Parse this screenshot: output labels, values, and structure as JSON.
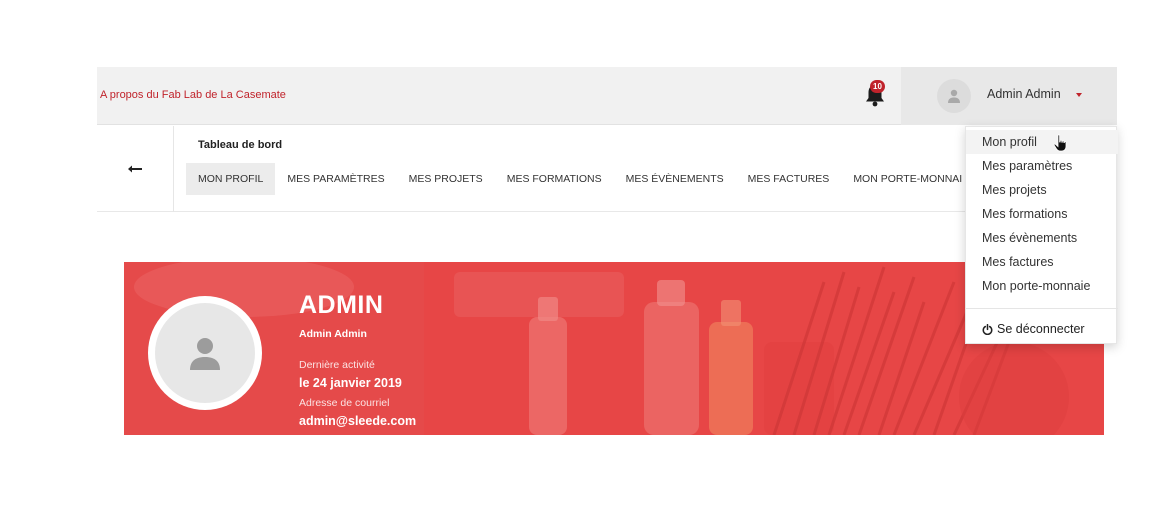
{
  "topbar": {
    "about_link": "A propos du Fab Lab de La Casemate",
    "notifications": {
      "count": "10",
      "icon": "bell-icon"
    },
    "user": {
      "name": "Admin Admin",
      "avatar_icon": "user-icon"
    }
  },
  "subnav": {
    "back_icon": "arrow-left-icon",
    "page_title": "Tableau de bord",
    "tabs": [
      {
        "label": "MON PROFIL",
        "active": true
      },
      {
        "label": "MES PARAMÈTRES"
      },
      {
        "label": "MES PROJETS"
      },
      {
        "label": "MES FORMATIONS"
      },
      {
        "label": "MES ÉVÈNEMENTS"
      },
      {
        "label": "MES FACTURES"
      },
      {
        "label": "MON PORTE-MONNAI"
      }
    ]
  },
  "dropdown": {
    "items": [
      {
        "label": "Mon profil"
      },
      {
        "label": "Mes paramètres"
      },
      {
        "label": "Mes projets"
      },
      {
        "label": "Mes formations"
      },
      {
        "label": "Mes évènements"
      },
      {
        "label": "Mes factures"
      },
      {
        "label": "Mon porte-monnaie"
      }
    ],
    "logout": {
      "label": "Se déconnecter",
      "icon": "power-icon"
    }
  },
  "profile": {
    "role": "ADMIN",
    "name": "Admin Admin",
    "last_activity_label": "Dernière activité",
    "last_activity_value": "le 24 janvier 2019",
    "email_label": "Adresse de courriel",
    "email_value": "admin@sleede.com"
  },
  "colors": {
    "accent": "#c0232b",
    "banner": "#e74a4a",
    "topbar_bg": "#f1f1f1"
  }
}
